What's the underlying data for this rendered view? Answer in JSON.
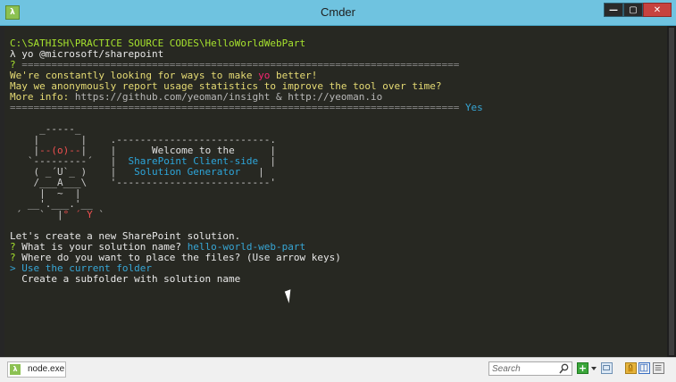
{
  "window": {
    "title": "Cmder",
    "app_icon": "lambda-icon",
    "buttons": {
      "minimize_label": "—",
      "maximize_label": "▢",
      "close_label": "✕"
    }
  },
  "console": {
    "path_line": "C:\\SATHISH\\PRACTICE SOURCE CODES\\HelloWorldWebPart",
    "prompt_symbol": "λ",
    "command": " yo @microsoft/sharepoint",
    "question_mark": "?",
    "separator_top": " ==========================================================================",
    "yeoman_intro_before": "We're constantly looking for ways to make ",
    "yeoman_intro_yo": "yo",
    "yeoman_intro_after": " better!",
    "yeoman_question": "May we anonymously report usage statistics to improve the tool over time?",
    "more_info_label": "More info: ",
    "more_info_links": "https://github.com/yeoman/insight & http://yeoman.io",
    "separator_answer": "============================================================================ ",
    "answer_yes": "Yes",
    "ascii_art": {
      "row1": "     _-----_",
      "row2": "    |       |    ",
      "row2_box": ".--------------------------.",
      "row3_left": "    |",
      "row3_mid": "--(o)--",
      "row3_right": "|    |",
      "row3_box": "      Welcome to the      ",
      "row3_end": "|",
      "row4": "   `---------´   |  ",
      "row4_box": "SharePoint Client-side",
      "row4_end": "  |",
      "row5": "    ( _´U`_ )    |   ",
      "row5_box": "Solution Generator",
      "row5_end": "   |",
      "row6": "    /___A___\\    '--------------------------'",
      "row7": "     |  ~  |",
      "row8": "   __'.___.'__",
      "row9_left": " ´   `  |",
      "row9_mid": "° ´ Y",
      "row9_right": " `"
    },
    "create_line": "Let's create a new SharePoint solution.",
    "q_name_label": " What is your solution name? ",
    "q_name_value": "hello-world-web-part",
    "q_place_label": " Where do you want to place the files?",
    "q_place_hint": " (Use arrow keys)",
    "selection_pointer": ">",
    "option_current": " Use the current folder",
    "option_subfolder": "  Create a subfolder with solution name"
  },
  "statusbar": {
    "tab_label": "node.exe",
    "tab_icon": "lambda-icon",
    "search_placeholder": "Search",
    "add_icon_label": "+",
    "icons": [
      "search-icon",
      "add-icon",
      "dropdown-arrow-icon",
      "view-icon",
      "lock-icon",
      "split-icon",
      "menu-icon"
    ]
  },
  "colors": {
    "titlebar": "#6fc3e0",
    "console_bg": "#272822",
    "path_green": "#a6e22e",
    "question_yellow": "#e6db74",
    "answer_cyan": "#37a6d5",
    "accent_red": "#f92672"
  }
}
